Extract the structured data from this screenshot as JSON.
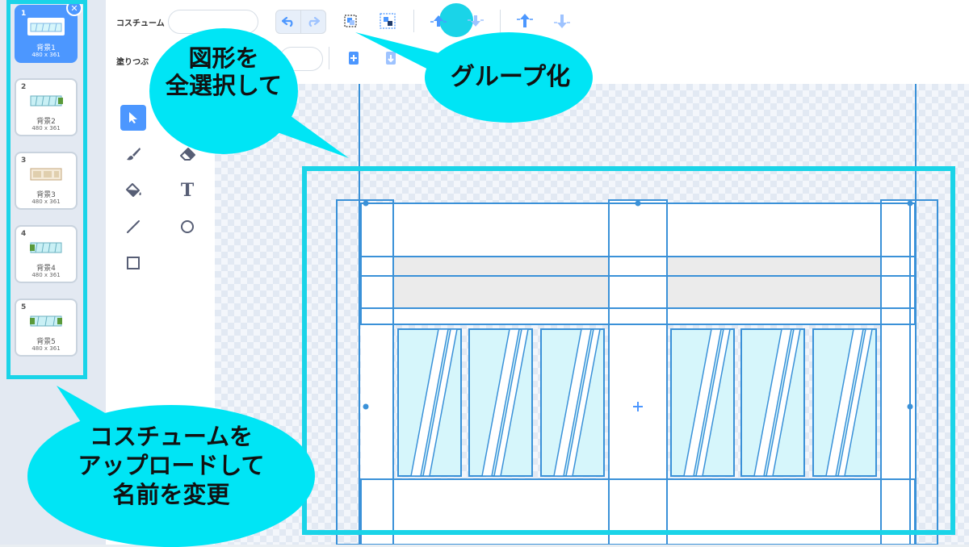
{
  "costumes": [
    {
      "number": "1",
      "name": "背景1",
      "size": "480 x 361",
      "selected": true
    },
    {
      "number": "2",
      "name": "背景2",
      "size": "480 x 361",
      "selected": false
    },
    {
      "number": "3",
      "name": "背景3",
      "size": "480 x 361",
      "selected": false
    },
    {
      "number": "4",
      "name": "背景4",
      "size": "480 x 361",
      "selected": false
    },
    {
      "number": "5",
      "name": "背景5",
      "size": "480 x 361",
      "selected": false
    }
  ],
  "toolbar": {
    "costume_label": "コスチューム",
    "fill_label": "塗りつぶ",
    "icons": [
      "undo-icon",
      "redo-icon",
      "group-icon",
      "ungroup-icon",
      "forward-icon",
      "backward-icon",
      "front-icon",
      "back-icon",
      "copy-icon",
      "paste-icon"
    ]
  },
  "tools": [
    "select-icon",
    "brush-icon",
    "eraser-icon",
    "fill-icon",
    "text-icon",
    "line-icon",
    "circle-icon",
    "rectangle-icon"
  ],
  "tool_text_glyph": "T",
  "callouts": {
    "select_all": "図形を\n全選択して",
    "group": "グループ化",
    "upload": "コスチュームを\nアップロードして\n名前を変更"
  },
  "colors": {
    "accent": "#4c97ff",
    "highlight": "#1ad4e8",
    "callout_fill": "#00e5f5"
  }
}
